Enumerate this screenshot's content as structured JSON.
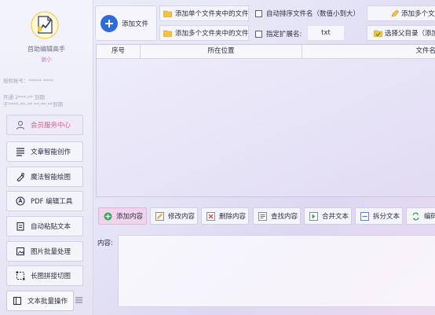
{
  "sidebar": {
    "app_name": "首助编辑高手",
    "user_name": "谢小",
    "account_line": "授权帐号：*****  ****",
    "info_lines": [
      "开通 2***-** 到期",
      "于****-**-** **:**:**到期"
    ],
    "vip_label": "会员服务中心",
    "items": [
      {
        "label": "文章智能创作",
        "icon": "article-lines-icon"
      },
      {
        "label": "魔法智能绘图",
        "icon": "magic-draw-icon"
      },
      {
        "label": "PDF 编辑工具",
        "icon": "pdf-tool-icon"
      },
      {
        "label": "自动粘贴文本",
        "icon": "auto-paste-icon"
      },
      {
        "label": "图片批量处理",
        "icon": "image-batch-icon"
      },
      {
        "label": "长图拼接切图",
        "icon": "crop-icon"
      },
      {
        "label": "文本批量操作",
        "icon": "text-batch-icon"
      }
    ]
  },
  "toolbar": {
    "add_file": "添加文件",
    "add_single_folder": "添加单个文件夹中的文件",
    "add_multi_folder": "添加多个文件夹中的文件",
    "auto_sort": "自动排序文件名（数值小到大）",
    "ext_label": "指定扩展名:",
    "ext_value": "txt",
    "add_multi_right": "添加多个文",
    "select_parent": "选择父目录（添加"
  },
  "table": {
    "columns": [
      "序号",
      "所在位置",
      "文件名"
    ]
  },
  "actions": [
    {
      "label": "添加内容",
      "icon": "add-content-icon"
    },
    {
      "label": "修改内容",
      "icon": "edit-content-icon"
    },
    {
      "label": "删除内容",
      "icon": "delete-content-icon"
    },
    {
      "label": "查找内容",
      "icon": "find-content-icon"
    },
    {
      "label": "合并文本",
      "icon": "merge-text-icon"
    },
    {
      "label": "拆分文本",
      "icon": "split-text-icon"
    },
    {
      "label": "编码",
      "icon": "encoding-icon"
    }
  ],
  "content": {
    "label": "内容:",
    "value": ""
  },
  "colors": {
    "accent_blue": "#2f6bd8",
    "vip_pink": "#dd5f8d",
    "active_button": "#f0d4ec"
  }
}
